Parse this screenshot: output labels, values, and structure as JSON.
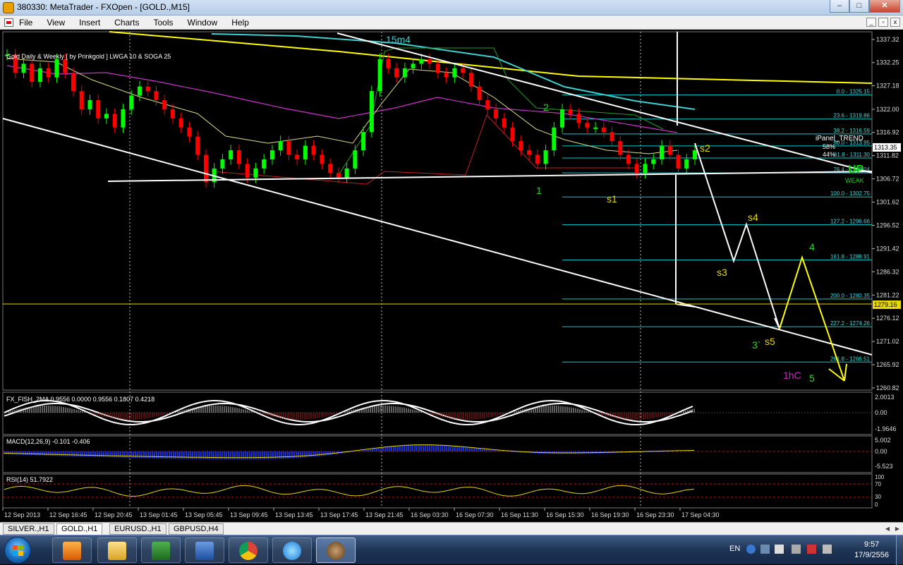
{
  "window": {
    "title": "380330: MetaTrader - FXOpen - [GOLD.,M15]",
    "buttons": {
      "minimize": "–",
      "maximize": "□",
      "close": "✕"
    }
  },
  "menu": {
    "items": [
      "File",
      "View",
      "Insert",
      "Charts",
      "Tools",
      "Window",
      "Help"
    ],
    "mdi_buttons": [
      "_",
      "▫",
      "x"
    ]
  },
  "chart": {
    "indicator_label": "Gold Daily & Weekly [ by Prinkgold ]  LWGA 10  &  SOGA 25",
    "price_scale": [
      "1337.32",
      "1332.25",
      "1327.18",
      "1322.00",
      "1316.92",
      "1311.82",
      "1306.72",
      "1301.62",
      "1296.52",
      "1291.42",
      "1286.32",
      "1281.22",
      "1276.12",
      "1271.02",
      "1265.92",
      "1260.82"
    ],
    "current_price": "1313.35",
    "hline_price": "1279.16",
    "fib_levels": [
      "0.0 - 1325.15",
      "23.6 - 1319.86",
      "38.2 - 1316.59",
      "50.0 - 1313.95",
      "61.8 - 1311.30",
      "76.4 - 1308.04",
      "100.0 - 1302.75",
      "127.2 - 1296.66",
      "161.8 - 1288.91",
      "200.0 - 1280.35",
      "227.2 - 1274.26",
      "261.8 - 1266.51"
    ],
    "panel": {
      "title": "iPanel_TREND",
      "line1": "58%",
      "line2": "44%",
      "trend": "UP",
      "strength": "WEAK"
    },
    "wave_labels": {
      "top": "15m4",
      "w2": "2",
      "w1": "1",
      "s1": "s1",
      "s2": "s2",
      "s3": "s3",
      "s4": "s4",
      "s5": "s5",
      "w3": "3`",
      "w4": "4",
      "w5": "5",
      "hc": "1hC"
    },
    "fish_label": "FX_FISH_2MA 0.9556 0.0000 0.9556 0.1807 0.4218",
    "fish_scale": [
      "2.0013",
      "0.00",
      "-1.9646"
    ],
    "macd_label": "MACD(12,26,9) -0.101 -0.406",
    "macd_scale": [
      "5.002",
      "0.00",
      "-5.523"
    ],
    "rsi_label": "RSI(14) 51.7922",
    "rsi_scale": [
      "100",
      "70",
      "30",
      "0"
    ],
    "time_axis": [
      "12 Sep 2013",
      "12 Sep 16:45",
      "12 Sep 20:45",
      "13 Sep 01:45",
      "13 Sep 05:45",
      "13 Sep 09:45",
      "13 Sep 13:45",
      "13 Sep 17:45",
      "13 Sep 21:45",
      "16 Sep 03:30",
      "16 Sep 07:30",
      "16 Sep 11:30",
      "16 Sep 15:30",
      "16 Sep 19:30",
      "16 Sep 23:30",
      "17 Sep 04:30"
    ],
    "colors": {
      "bull": "#00ff00",
      "bear": "#ff0000",
      "fib": "#00ffff",
      "trend": "#ffffff",
      "yellow": "#ffff00",
      "magenta": "#ff00ff"
    }
  },
  "tabs": [
    "SILVER.,H1",
    "GOLD.,H1",
    "EURUSD.,H1",
    "GBPUSD,H4"
  ],
  "active_tab": "GOLD.,H1",
  "taskbar": {
    "apps": [
      "media-player-icon",
      "folder-icon",
      "excel-icon",
      "word-icon",
      "chrome-icon",
      "internet-explorer-icon",
      "metatrader-icon"
    ],
    "lang": "EN",
    "time": "9:57",
    "date": "17/9/2556"
  }
}
